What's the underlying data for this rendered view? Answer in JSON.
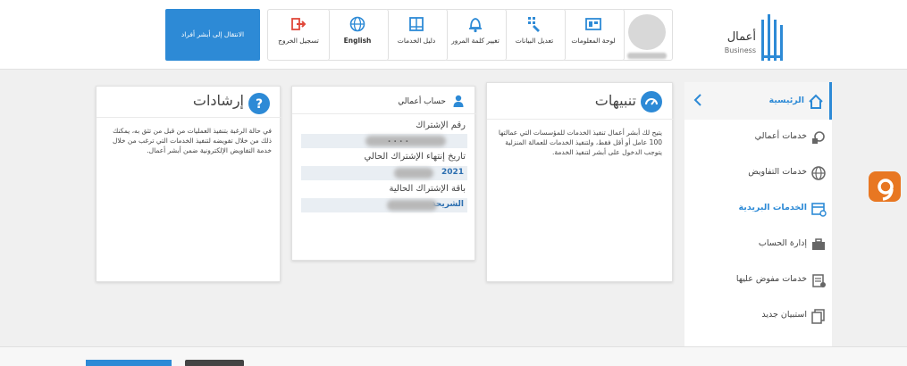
{
  "header": {
    "logo_text": "أعمال",
    "logo_sub": "Business",
    "tiles": {
      "dashboard": "لوحة المعلومات",
      "edit_data": "تعديل البيانات",
      "change_password": "تغيير كلمة المرور",
      "services_guide": "دليل الخدمات",
      "language": "English",
      "logout": "تسجيل الخروج"
    },
    "switch_label": "الانتقال إلى أبشر أفراد"
  },
  "sidebar": {
    "items": [
      {
        "label": "الرئيسية"
      },
      {
        "label": "خدمات أعمالي"
      },
      {
        "label": "خدمات التفاويض"
      },
      {
        "label": "الخدمات البريدية"
      },
      {
        "label": "إدارة الحساب"
      },
      {
        "label": "خدمات مفوض عليها"
      },
      {
        "label": "استبيان جديد"
      }
    ]
  },
  "alerts": {
    "title": "تنبيهات",
    "body": "يتيح لك أبشر أعمال تنفيذ الخدمات للمؤسسات التي عمالتها 100 عامل أو أقل فقط، ولتنفيذ الخدمات للعمالة المنزلية يتوجب الدخول على أبشر لتنفيذ الخدمة."
  },
  "account": {
    "title": "حساب أعمالي",
    "subscription_number_label": "رقم الإشتراك",
    "subscription_number_value": ". . . .",
    "expiry_label": "تاريخ إنتهاء الإشتراك الحالي",
    "expiry_value": "2021",
    "package_label": "باقة الإشتراك الحالية",
    "package_value": "الشريحة"
  },
  "guidance": {
    "title": "إرشادات",
    "body": "في حالة الرغبة بتنفيذ العمليات من قبل من تثق به، يمكنك ذلك من خلال تفويضه لتنفيذ الخدمات التي ترغب من خلال خدمة التفاويض الإلكترونية ضمن أبشر أعمال."
  },
  "colors": {
    "accent": "#2d8ad6",
    "fab": "#e87722"
  }
}
